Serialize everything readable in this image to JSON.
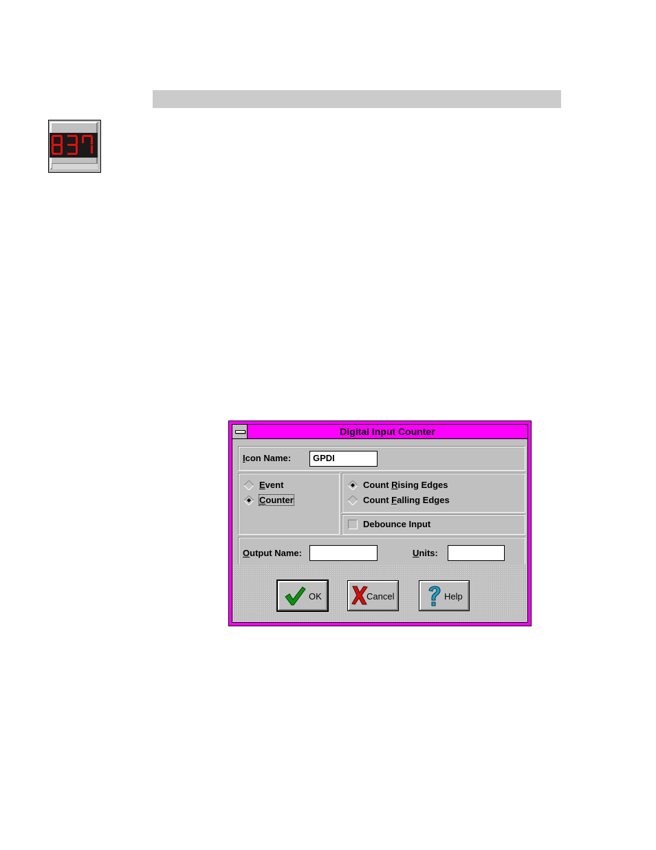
{
  "page": {
    "icon_name": "seven-segment-counter-icon",
    "icon_digits": "837"
  },
  "dialog": {
    "title": "Digital Input Counter",
    "icon_name": {
      "label_mnemonic": "I",
      "label_rest": "con Name:",
      "value": "GPDI"
    },
    "mode": {
      "options": [
        {
          "mnemonic": "E",
          "rest": "vent",
          "selected": false
        },
        {
          "mnemonic": "C",
          "rest": "ounter",
          "selected": true
        }
      ]
    },
    "edge": {
      "options": [
        {
          "before": "Count ",
          "mnemonic": "R",
          "rest": "ising Edges",
          "selected": true
        },
        {
          "before": "Count ",
          "mnemonic": "F",
          "rest": "alling Edges",
          "selected": false
        }
      ]
    },
    "debounce": {
      "label": "Debounce Input",
      "checked": false
    },
    "output_name": {
      "label_mnemonic": "O",
      "label_rest": "utput Name:",
      "value": ""
    },
    "units": {
      "label_mnemonic": "U",
      "label_rest": "nits:",
      "value": ""
    },
    "buttons": {
      "ok": "OK",
      "cancel": "Cancel",
      "help": "Help"
    },
    "colors": {
      "title_bar": "#ff00ff",
      "face": "#c0c0c0"
    }
  }
}
